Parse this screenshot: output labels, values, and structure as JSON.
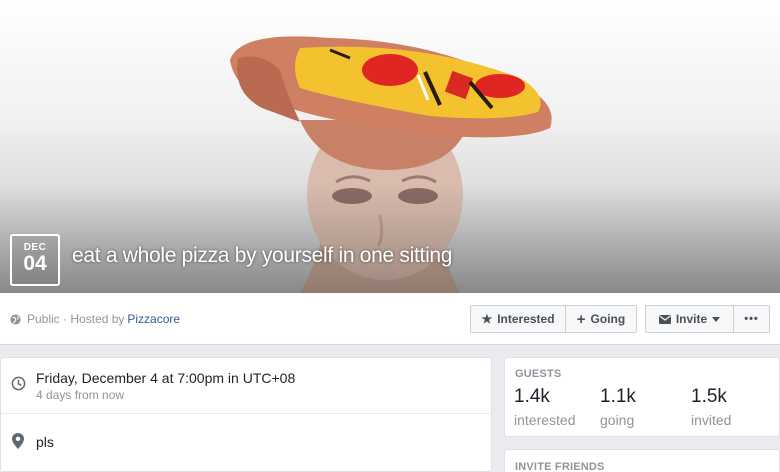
{
  "cover": {
    "image": "pizza-hat-on-mannequin-head",
    "date_month": "DEC",
    "date_day": "04",
    "title": "eat a whole pizza by yourself in one sitting"
  },
  "action_bar": {
    "privacy_text": "Public · Hosted by",
    "host_name": "Pizzacore",
    "interested_label": "Interested",
    "going_label": "Going",
    "invite_label": "Invite",
    "more_label": "•••",
    "icons": [
      "globe-icon",
      "star-icon",
      "plus-icon",
      "envelope-icon",
      "chevron-down-icon",
      "more-icon"
    ]
  },
  "details": {
    "time_main": "Friday, December 4 at 7:00pm in UTC+08",
    "time_sub": "4 days from now",
    "location": "pls",
    "icons": [
      "clock-icon",
      "location-pin-icon"
    ]
  },
  "guests": {
    "heading": "GUESTS",
    "stats": [
      {
        "value": "1.4k",
        "label": "interested"
      },
      {
        "value": "1.1k",
        "label": "going"
      },
      {
        "value": "1.5k",
        "label": "invited"
      }
    ]
  },
  "invite_friends": {
    "heading": "INVITE FRIENDS"
  },
  "colors": {
    "link": "#365899",
    "muted": "#90949c",
    "page_bg": "#e9ebee",
    "button_bg": "#f6f7f9"
  }
}
